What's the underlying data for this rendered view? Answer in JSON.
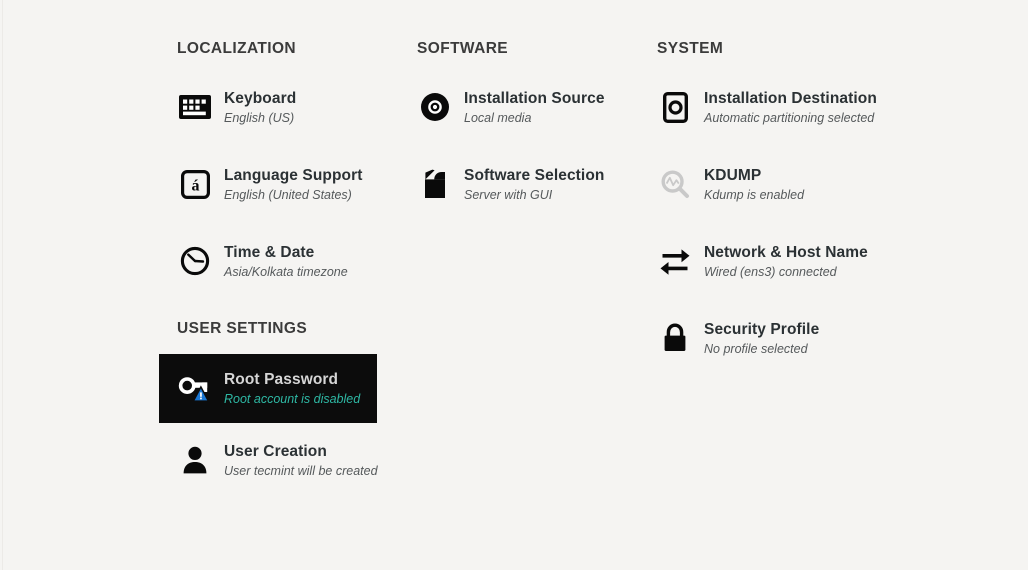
{
  "theme": {
    "background": "#f5f4f2",
    "selected_background": "#0c0c0c",
    "title_color": "#2b3134",
    "subtitle_color": "#55595b",
    "selected_title_color": "#d6d6d6",
    "selected_subtitle_color": "#2eb8a4",
    "warning_badge_color": "#1a76d2",
    "muted_icon_color": "#c9c9c9"
  },
  "columns": [
    {
      "id": "localization",
      "heading": "LOCALIZATION",
      "items": [
        {
          "id": "keyboard",
          "icon": "keyboard-icon",
          "title": "Keyboard",
          "subtitle": "English (US)",
          "selected": false
        },
        {
          "id": "language-support",
          "icon": "language-support-icon",
          "title": "Language Support",
          "subtitle": "English (United States)",
          "selected": false
        },
        {
          "id": "time-and-date",
          "icon": "clock-icon",
          "title": "Time & Date",
          "subtitle": "Asia/Kolkata timezone",
          "selected": false
        }
      ]
    },
    {
      "id": "software",
      "heading": "SOFTWARE",
      "items": [
        {
          "id": "installation-source",
          "icon": "disc-icon",
          "title": "Installation Source",
          "subtitle": "Local media",
          "selected": false
        },
        {
          "id": "software-selection",
          "icon": "package-icon",
          "title": "Software Selection",
          "subtitle": "Server with GUI",
          "selected": false
        }
      ]
    },
    {
      "id": "system",
      "heading": "SYSTEM",
      "items": [
        {
          "id": "installation-destination",
          "icon": "harddrive-icon",
          "title": "Installation Destination",
          "subtitle": "Automatic partitioning selected",
          "selected": false
        },
        {
          "id": "kdump",
          "icon": "magnifier-waveform-icon",
          "title": "KDUMP",
          "subtitle": "Kdump is enabled",
          "selected": false
        },
        {
          "id": "network-and-host-name",
          "icon": "network-arrows-icon",
          "title": "Network & Host Name",
          "subtitle": "Wired (ens3) connected",
          "selected": false
        },
        {
          "id": "security-profile",
          "icon": "lock-icon",
          "title": "Security Profile",
          "subtitle": "No profile selected",
          "selected": false
        }
      ]
    }
  ],
  "user_settings": {
    "heading": "USER SETTINGS",
    "items": [
      {
        "id": "root-password",
        "icon": "key-warning-icon",
        "title": "Root Password",
        "subtitle": "Root account is disabled",
        "selected": true
      },
      {
        "id": "user-creation",
        "icon": "user-icon",
        "title": "User Creation",
        "subtitle": "User tecmint will be created",
        "selected": false
      }
    ]
  }
}
